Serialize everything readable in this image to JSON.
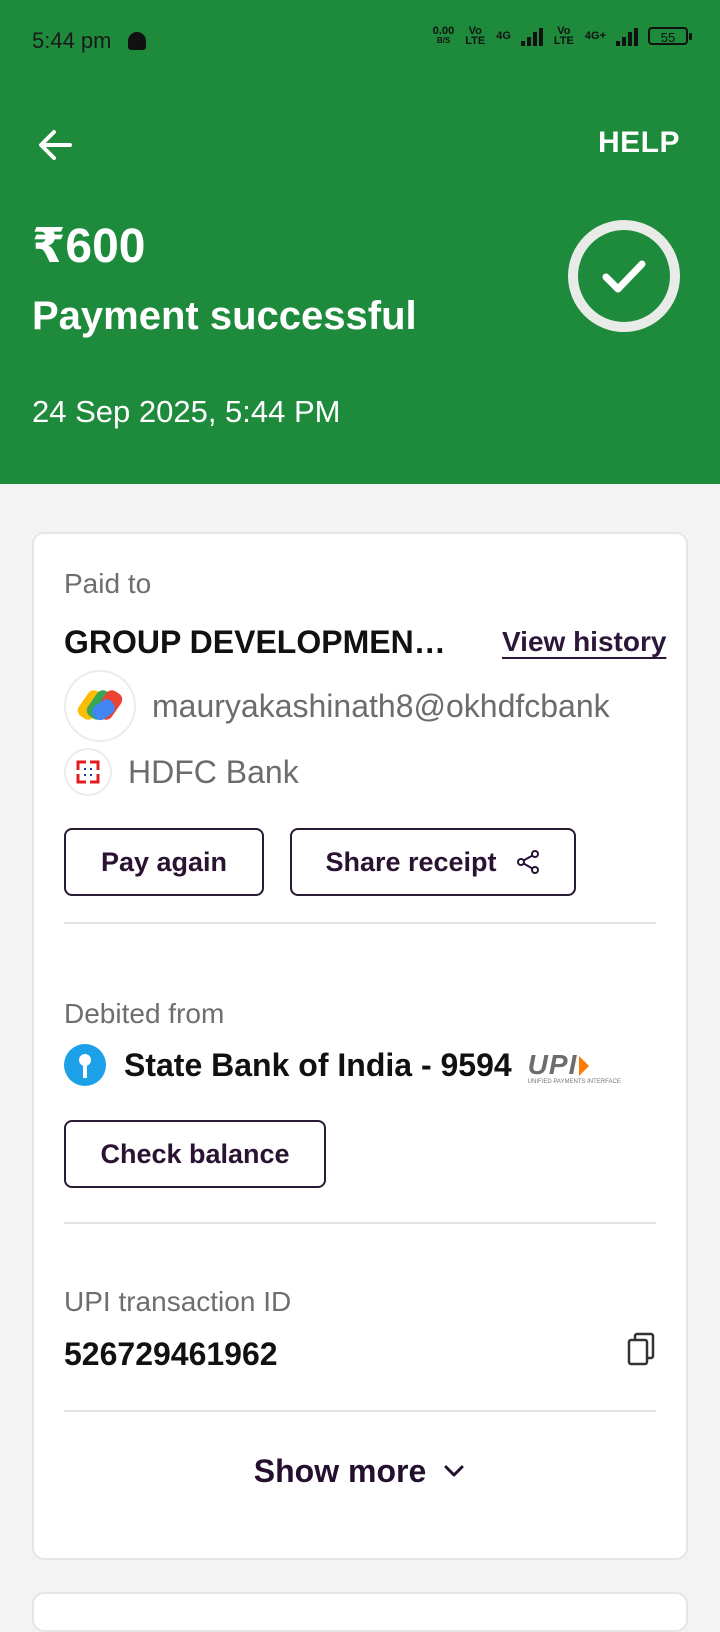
{
  "status": {
    "time": "5:44 pm",
    "net_speed": "0.00",
    "net_unit": "B/S",
    "volte_1": "Vo LTE",
    "net_1": "4G",
    "volte_2": "Vo LTE",
    "net_2": "4G+",
    "battery": "55"
  },
  "header": {
    "help_label": "HELP",
    "amount": "₹600",
    "status_text": "Payment successful",
    "datetime": "24 Sep 2025, 5:44 PM"
  },
  "paid_to": {
    "label": "Paid to",
    "merchant": "GROUP DEVELOPMENT ...",
    "view_history": "View history",
    "upi_id": "mauryakashinath8@okhdfcbank",
    "bank": "HDFC Bank"
  },
  "actions": {
    "pay_again": "Pay again",
    "share_receipt": "Share receipt",
    "check_balance": "Check balance",
    "show_more": "Show more"
  },
  "debited": {
    "label": "Debited from",
    "account": "State Bank of India - 9594",
    "upi_logo": "UPI",
    "upi_tagline": "UNIFIED PAYMENTS INTERFACE"
  },
  "transaction": {
    "label": "UPI transaction ID",
    "id": "526729461962"
  },
  "colors": {
    "header_green": "#1e8a3b",
    "button_text": "#2a1232"
  }
}
